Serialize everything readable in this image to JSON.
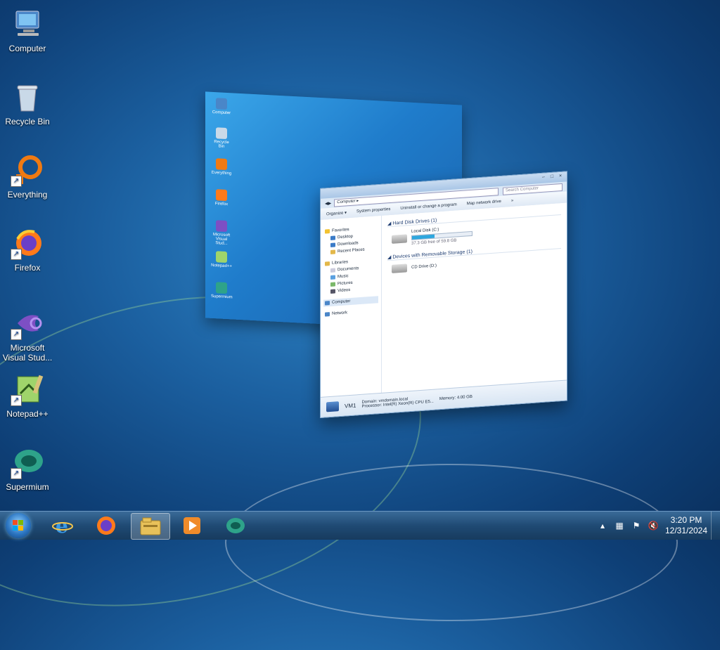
{
  "desktop": {
    "icons": [
      {
        "label": "Computer",
        "icon": "computer-icon",
        "shortcut": false
      },
      {
        "label": "Recycle Bin",
        "icon": "recycle-bin-icon",
        "shortcut": false
      },
      {
        "label": "Everything",
        "icon": "everything-icon",
        "shortcut": true
      },
      {
        "label": "Firefox",
        "icon": "firefox-icon",
        "shortcut": true
      },
      {
        "label": "Microsoft Visual Stud...",
        "icon": "visual-studio-icon",
        "shortcut": true
      },
      {
        "label": "Notepad++",
        "icon": "notepadpp-icon",
        "shortcut": true
      },
      {
        "label": "Supermium",
        "icon": "supermium-icon",
        "shortcut": true
      }
    ]
  },
  "flip_window": {
    "mini_icons": [
      "Computer",
      "Recycle Bin",
      "Everything",
      "Firefox",
      "Microsoft Visual Stud...",
      "Notepad++",
      "Supermium"
    ]
  },
  "explorer": {
    "address": "Computer",
    "search_placeholder": "Search Computer",
    "toolbar": [
      "Organize ▾",
      "System properties",
      "Uninstall or change a program",
      "Map network drive",
      "»"
    ],
    "nav": {
      "favorites": "Favorites",
      "favorites_items": [
        "Desktop",
        "Downloads",
        "Recent Places"
      ],
      "libraries": "Libraries",
      "libraries_items": [
        "Documents",
        "Music",
        "Pictures",
        "Videos"
      ],
      "computer": "Computer",
      "network": "Network"
    },
    "sections": {
      "hard_disk": "Hard Disk Drives (1)",
      "removable": "Devices with Removable Storage (1)"
    },
    "local_disk": {
      "name": "Local Disk (C:)",
      "free_text": "37.3 GB free of 59.8 GB",
      "used_fraction": 0.38
    },
    "cd_drive": {
      "name": "CD Drive (D:)"
    },
    "status": {
      "name": "VM1",
      "domain": "Domain: vmdomain.local",
      "memory": "Memory: 4.00 GB",
      "processor": "Processor: Intel(R) Xeon(R) CPU E5..."
    }
  },
  "taskbar": {
    "clock_time": "3:20 PM",
    "clock_date": "12/31/2024",
    "pinned": [
      "internet-explorer-icon",
      "firefox-icon",
      "explorer-icon",
      "media-player-icon",
      "supermium-icon"
    ],
    "tray": [
      "show-hidden-icons-chevron",
      "network-icon",
      "action-center-flag-icon",
      "volume-muted-icon"
    ]
  }
}
